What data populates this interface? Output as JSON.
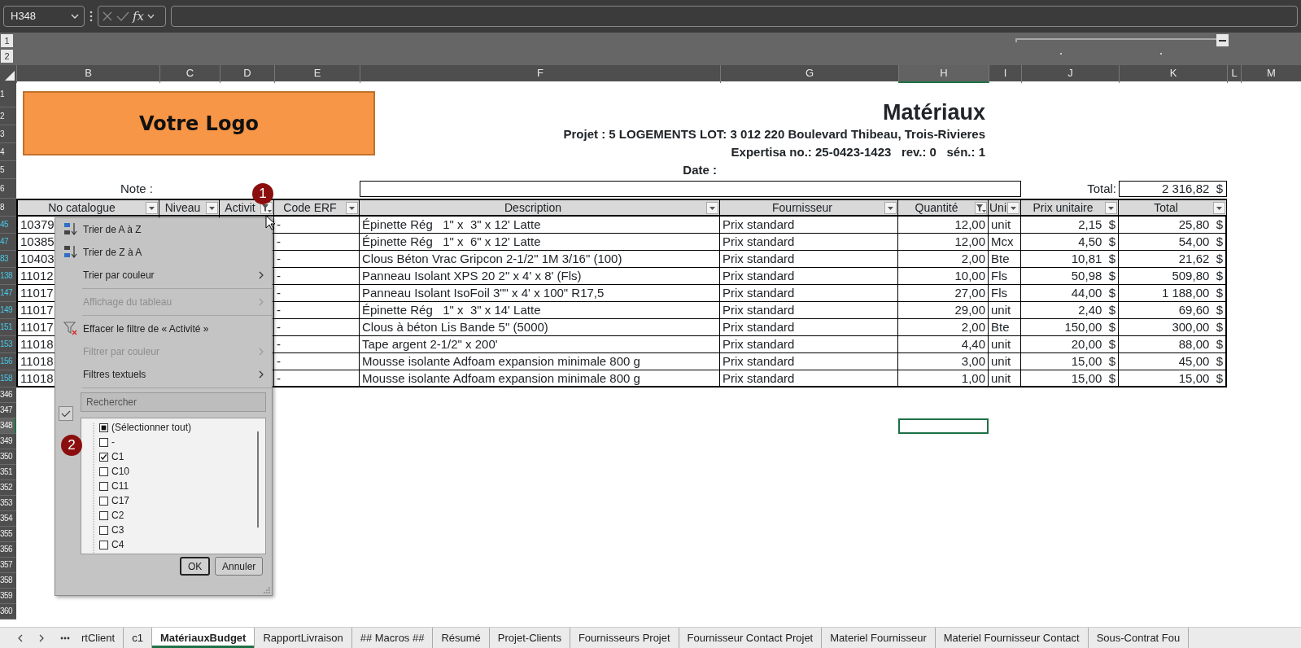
{
  "formula_bar": {
    "name_box": "H348",
    "function_label": "fx"
  },
  "outline": {
    "levels": [
      "1",
      "2"
    ]
  },
  "columns": [
    {
      "letter": "B",
      "selected": false
    },
    {
      "letter": "C",
      "selected": false
    },
    {
      "letter": "D",
      "selected": false
    },
    {
      "letter": "E",
      "selected": false
    },
    {
      "letter": "F",
      "selected": false
    },
    {
      "letter": "G",
      "selected": false
    },
    {
      "letter": "H",
      "selected": true
    },
    {
      "letter": "I",
      "selected": false
    },
    {
      "letter": "J",
      "selected": false
    },
    {
      "letter": "K",
      "selected": false
    },
    {
      "letter": "L",
      "selected": false
    },
    {
      "letter": "M",
      "selected": false
    }
  ],
  "top_rows": [
    "1",
    "2",
    "3",
    "4",
    "5",
    "6"
  ],
  "sheet": {
    "logo": "Votre Logo",
    "title": "Matériaux",
    "project": "Projet : 5 LOGEMENTS LOT: 3 012 220 Boulevard Thibeau, Trois-Rivieres",
    "expertise": "Expertisa no.: 25-0423-1423   rev.: 0   sén.: 1",
    "date_label": "Date :",
    "note_label": "Note :",
    "total_label": "Total:",
    "total_value": "2 316,82  $"
  },
  "table": {
    "header_row": "8",
    "headers": [
      {
        "label": "No catalogue",
        "filtered": false
      },
      {
        "label": "Niveau",
        "filtered": false
      },
      {
        "label": "Activit",
        "filtered": true
      },
      {
        "label": "Code ERF",
        "filtered": false
      },
      {
        "label": "Description",
        "filtered": false
      },
      {
        "label": "Fournisseur",
        "filtered": false
      },
      {
        "label": "Quantité",
        "filtered": true
      },
      {
        "label": "Uni",
        "filtered": false
      },
      {
        "label": "Prix unitaire",
        "filtered": false
      },
      {
        "label": "Total",
        "filtered": false
      }
    ],
    "rows": [
      {
        "row_number": "45",
        "filtered": true,
        "catalogue": "10379",
        "code_erp": "-",
        "description": "Épinette Rég   1\" x  3\" x 12' Latte",
        "supplier": "Prix standard",
        "quantity": "12,00",
        "unit": "unit",
        "unit_price": "2,15  $",
        "total": "25,80  $"
      },
      {
        "row_number": "47",
        "filtered": true,
        "catalogue": "10385",
        "code_erp": "-",
        "description": "Épinette Rég   1\" x  6\" x 12' Latte",
        "supplier": "Prix standard",
        "quantity": "12,00",
        "unit": "Mcx",
        "unit_price": "4,50  $",
        "total": "54,00  $"
      },
      {
        "row_number": "83",
        "filtered": true,
        "catalogue": "10403",
        "code_erp": "-",
        "description": "Clous Béton Vrac Gripcon 2-1/2\" 1M 3/16\" (100)",
        "supplier": "Prix standard",
        "quantity": "2,00",
        "unit": "Bte",
        "unit_price": "10,81  $",
        "total": "21,62  $"
      },
      {
        "row_number": "138",
        "filtered": true,
        "catalogue": "11012",
        "code_erp": "-",
        "description": "Panneau Isolant XPS 20 2\" x 4' x 8' (Fls)",
        "supplier": "Prix standard",
        "quantity": "10,00",
        "unit": "Fls",
        "unit_price": "50,98  $",
        "total": "509,80  $"
      },
      {
        "row_number": "147",
        "filtered": true,
        "catalogue": "11017",
        "code_erp": "-",
        "description": "Panneau Isolant IsoFoil 3\"\" x 4' x 100\" R17,5",
        "supplier": "Prix standard",
        "quantity": "27,00",
        "unit": "Fls",
        "unit_price": "44,00  $",
        "total": "1 188,00  $"
      },
      {
        "row_number": "149",
        "filtered": true,
        "catalogue": "11017",
        "code_erp": "-",
        "description": "Épinette Rég   1\" x  3\" x 14' Latte",
        "supplier": "Prix standard",
        "quantity": "29,00",
        "unit": "unit",
        "unit_price": "2,40  $",
        "total": "69,60  $"
      },
      {
        "row_number": "151",
        "filtered": true,
        "catalogue": "11017",
        "code_erp": "-",
        "description": "Clous à béton Lis Bande 5\" (5000)",
        "supplier": "Prix standard",
        "quantity": "2,00",
        "unit": "Bte",
        "unit_price": "150,00  $",
        "total": "300,00  $"
      },
      {
        "row_number": "153",
        "filtered": true,
        "catalogue": "11018",
        "code_erp": "-",
        "description": "Tape argent 2-1/2\" x 200'",
        "supplier": "Prix standard",
        "quantity": "4,40",
        "unit": "unit",
        "unit_price": "20,00  $",
        "total": "88,00  $"
      },
      {
        "row_number": "156",
        "filtered": true,
        "catalogue": "11018",
        "code_erp": "-",
        "description": "Mousse isolante Adfoam expansion minimale 800 g",
        "supplier": "Prix standard",
        "quantity": "3,00",
        "unit": "unit",
        "unit_price": "15,00  $",
        "total": "45,00  $"
      },
      {
        "row_number": "158",
        "filtered": true,
        "catalogue": "11018",
        "code_erp": "-",
        "description": "Mousse isolante Adfoam expansion minimale 800 g",
        "supplier": "Prix standard",
        "quantity": "1,00",
        "unit": "unit",
        "unit_price": "15,00  $",
        "total": "15,00  $"
      }
    ]
  },
  "blank_rows": [
    {
      "number": "346",
      "selected": false
    },
    {
      "number": "347",
      "selected": false
    },
    {
      "number": "348",
      "selected": true
    },
    {
      "number": "349",
      "selected": false
    },
    {
      "number": "350",
      "selected": false
    },
    {
      "number": "351",
      "selected": false
    },
    {
      "number": "352",
      "selected": false
    },
    {
      "number": "353",
      "selected": false
    },
    {
      "number": "354",
      "selected": false
    },
    {
      "number": "355",
      "selected": false
    },
    {
      "number": "356",
      "selected": false
    },
    {
      "number": "357",
      "selected": false
    },
    {
      "number": "358",
      "selected": false
    },
    {
      "number": "359",
      "selected": false
    },
    {
      "number": "360",
      "selected": false
    }
  ],
  "filter_menu": {
    "items": [
      {
        "kind": "sort-ascending",
        "label": "Trier de A à Z",
        "disabled": false
      },
      {
        "kind": "sort-descending",
        "label": "Trier de Z à A",
        "disabled": false
      },
      {
        "kind": "plain",
        "label": "Trier par couleur",
        "disabled": false,
        "submenu": true
      },
      {
        "kind": "separator"
      },
      {
        "kind": "plain",
        "label": "Affichage du tableau",
        "disabled": true,
        "submenu": true
      },
      {
        "kind": "separator"
      },
      {
        "kind": "clear-filter",
        "label": "Effacer le filtre de « Activité »",
        "disabled": false
      },
      {
        "kind": "plain",
        "label": "Filtrer par couleur",
        "disabled": true,
        "submenu": true
      },
      {
        "kind": "plain",
        "label": "Filtres textuels",
        "disabled": false,
        "submenu": true
      },
      {
        "kind": "separator"
      }
    ],
    "search": {
      "placeholder": "Rechercher"
    },
    "values": [
      {
        "label": "(Sélectionner tout)",
        "indeterminate": true
      },
      {
        "label": "-",
        "checked": false
      },
      {
        "label": "C1",
        "checked": true
      },
      {
        "label": "C10",
        "checked": false
      },
      {
        "label": "C11",
        "checked": false
      },
      {
        "label": "C17",
        "checked": false
      },
      {
        "label": "C2",
        "checked": false
      },
      {
        "label": "C3",
        "checked": false
      },
      {
        "label": "C4",
        "checked": false
      }
    ],
    "buttons": [
      {
        "label": "OK",
        "default": true
      },
      {
        "label": "Annuler",
        "default": false
      }
    ]
  },
  "annotations": [
    {
      "number": "1"
    },
    {
      "number": "2"
    }
  ],
  "tabs": [
    {
      "label": "rtClient",
      "selected": false
    },
    {
      "label": "c1",
      "selected": false
    },
    {
      "label": "MatériauxBudget",
      "selected": true
    },
    {
      "label": "RapportLivraison",
      "selected": false
    },
    {
      "label": "## Macros ##",
      "selected": false
    },
    {
      "label": "Résumé",
      "selected": false
    },
    {
      "label": "Projet-Clients",
      "selected": false
    },
    {
      "label": "Fournisseurs Projet",
      "selected": false
    },
    {
      "label": "Fournisseur Contact Projet",
      "selected": false
    },
    {
      "label": "Materiel Fournisseur",
      "selected": false
    },
    {
      "label": "Materiel Fournisseur Contact",
      "selected": false
    },
    {
      "label": "Sous-Contrat Fou",
      "selected": false
    }
  ]
}
